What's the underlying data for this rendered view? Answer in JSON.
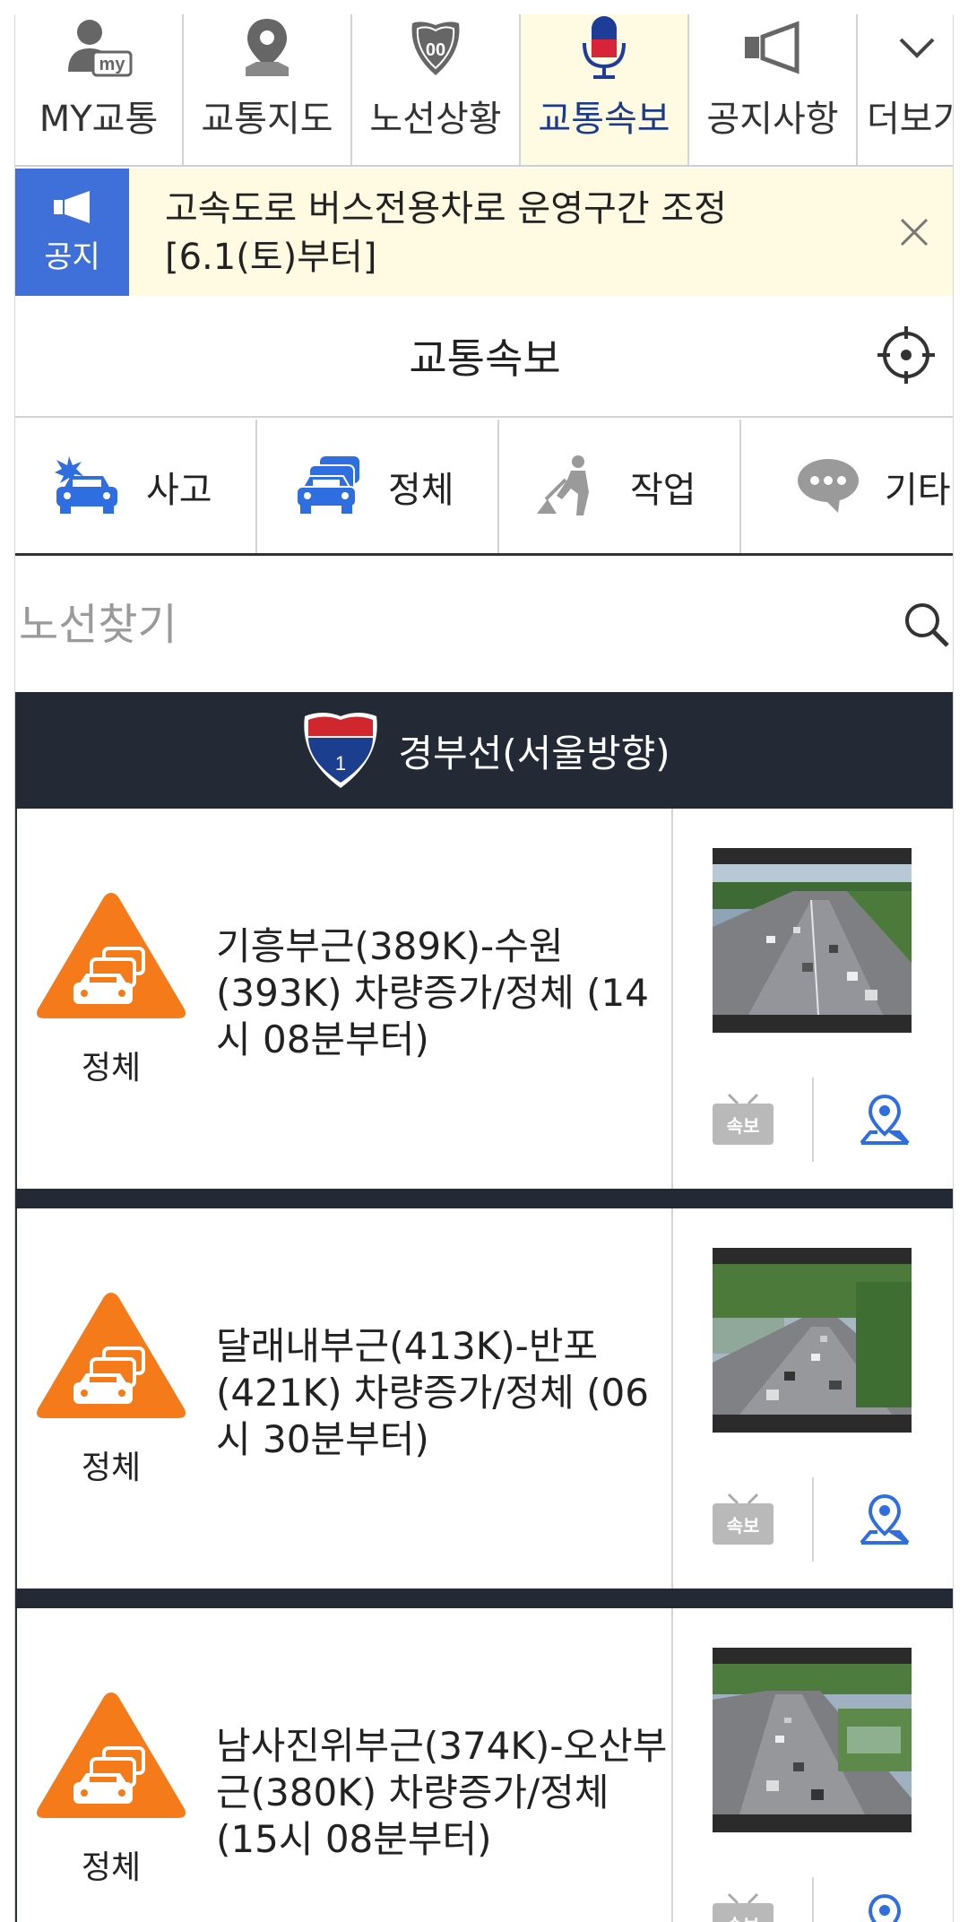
{
  "nav": {
    "tabs": [
      {
        "label": "MY교통",
        "icon": "my-traffic-icon"
      },
      {
        "label": "교통지도",
        "icon": "map-pin-icon"
      },
      {
        "label": "노선상황",
        "icon": "highway-shield-icon"
      },
      {
        "label": "교통속보",
        "icon": "microphone-icon",
        "active": true
      },
      {
        "label": "공지사항",
        "icon": "megaphone-icon"
      },
      {
        "label": "더보기",
        "icon": "chevron-down-icon"
      }
    ]
  },
  "notice": {
    "badge": "공지",
    "text": "고속도로 버스전용차로 운영구간 조정 [6.1(토)부터]"
  },
  "page": {
    "title": "교통속보"
  },
  "categories": [
    {
      "label": "사고",
      "icon": "accident-car-icon"
    },
    {
      "label": "정체",
      "icon": "congestion-cars-icon"
    },
    {
      "label": "작업",
      "icon": "road-work-icon"
    },
    {
      "label": "기타",
      "icon": "speech-bubble-icon"
    }
  ],
  "search": {
    "placeholder": "노선찾기"
  },
  "route": {
    "name": "경부선(서울방향)",
    "shield_number": "1"
  },
  "items": [
    {
      "type": "정체",
      "description": "기흥부근(389K)-수원(393K) 차량증가/정체 (14시 08분부터)",
      "news_label": "속보"
    },
    {
      "type": "정체",
      "description": "달래내부근(413K)-반포(421K) 차량증가/정체 (06시 30분부터)",
      "news_label": "속보"
    },
    {
      "type": "정체",
      "description": "남사진위부근(374K)-오산부근(380K) 차량증가/정체 (15시 08분부터)",
      "news_label": "속보"
    }
  ],
  "colors": {
    "accent_blue": "#3f6fd8",
    "active_tab_bg": "#fffbe3",
    "dark_header": "#232a36",
    "warning_orange": "#f47a1a"
  }
}
